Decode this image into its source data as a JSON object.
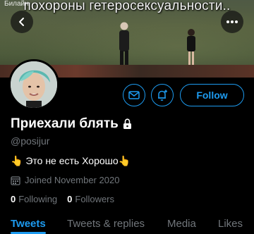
{
  "status_bar": {
    "text": "Билайн"
  },
  "banner": {
    "caption": "похороны гетеросексуальности.."
  },
  "profile": {
    "display_name": "Приехали блять",
    "handle": "@posijur",
    "bio": "👆 Это не есть Хорошо👆",
    "joined": "Joined November 2020",
    "following_count": "0",
    "following_label": "Following",
    "followers_count": "0",
    "followers_label": "Followers"
  },
  "actions": {
    "follow_label": "Follow"
  },
  "tabs": [
    {
      "label": "Tweets",
      "active": true
    },
    {
      "label": "Tweets & replies",
      "active": false
    },
    {
      "label": "Media",
      "active": false
    },
    {
      "label": "Likes",
      "active": false
    }
  ],
  "colors": {
    "accent": "#1d9bf0",
    "muted": "#71767b",
    "background": "#000000"
  },
  "icons": {
    "back": "arrow-left-icon",
    "more": "more-horizontal-icon",
    "message": "envelope-icon",
    "notify": "bell-plus-icon",
    "lock": "lock-icon",
    "calendar": "calendar-icon"
  }
}
